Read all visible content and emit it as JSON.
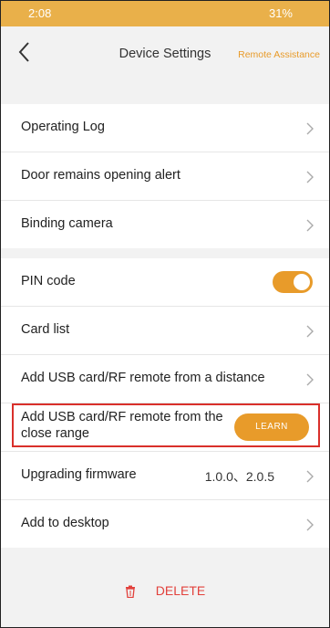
{
  "status_bar": {
    "time": "2:08",
    "battery": "31%"
  },
  "header": {
    "title": "Device Settings",
    "remote_assistance": "Remote Assistance"
  },
  "group1": [
    {
      "label": "Operating Log"
    },
    {
      "label": "Door remains opening alert"
    },
    {
      "label": "Binding camera"
    }
  ],
  "group2": {
    "pin_code": {
      "label": "PIN code",
      "enabled": true
    },
    "card_list": {
      "label": "Card list"
    },
    "add_distance": {
      "label": "Add USB card/RF remote from a distance"
    },
    "add_close": {
      "label": "Add USB card/RF remote from the close range",
      "button": "LEARN"
    },
    "firmware": {
      "label": "Upgrading firmware",
      "value": "1.0.0、2.0.5"
    },
    "desktop": {
      "label": "Add to desktop"
    }
  },
  "delete_label": "DELETE",
  "colors": {
    "accent": "#e89b2a",
    "danger": "#e2413c",
    "highlight": "#d9302b"
  }
}
